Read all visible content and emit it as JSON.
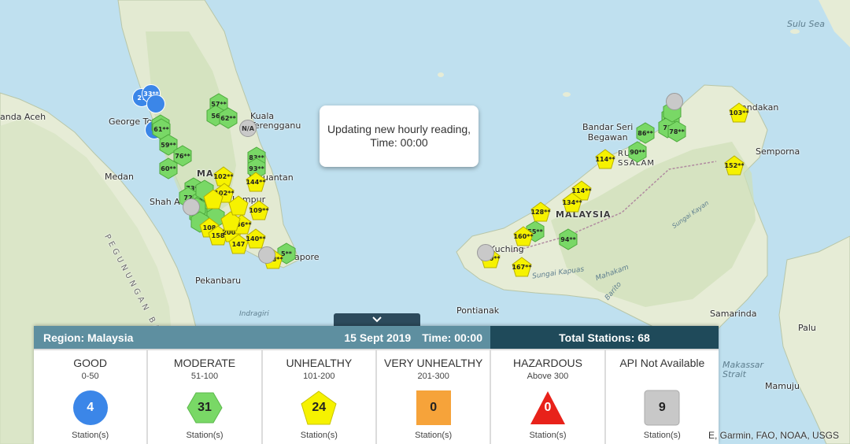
{
  "toast": {
    "line1": "Updating new hourly reading,",
    "line2": "Time: 00:00"
  },
  "panel": {
    "region": "Region: Malaysia",
    "date": "15 Sept 2019",
    "time": "Time: 00:00",
    "total": "Total Stations: 68",
    "categories": [
      {
        "title": "GOOD",
        "range": "0-50",
        "count": "4",
        "foot": "Station(s)",
        "shape": "circle",
        "color": "#3b86e8"
      },
      {
        "title": "MODERATE",
        "range": "51-100",
        "count": "31",
        "foot": "Station(s)",
        "shape": "hexagon",
        "color": "#79d866"
      },
      {
        "title": "UNHEALTHY",
        "range": "101-200",
        "count": "24",
        "foot": "Station(s)",
        "shape": "pentagon",
        "color": "#f6f200"
      },
      {
        "title": "VERY UNHEALTHY",
        "range": "201-300",
        "count": "0",
        "foot": "Station(s)",
        "shape": "square",
        "color": "#f6a33a"
      },
      {
        "title": "HAZARDOUS",
        "range": "Above 300",
        "count": "0",
        "foot": "Station(s)",
        "shape": "triangle",
        "color": "#e8221a"
      },
      {
        "title": "API Not Available",
        "range": "",
        "count": "9",
        "foot": "Station(s)",
        "shape": "rounded-square",
        "color": "#c8c8c8"
      }
    ]
  },
  "attribution": "E, Garmin, FAO, NOAA, USGS",
  "map_labels": {
    "sulu_sea": "Sulu Sea",
    "banda_aceh": "anda Aceh",
    "george_town": "George To",
    "medan": "Medan",
    "kuala_terengganu": "Kuala\nTerengganu",
    "shah_alam": "Shah A",
    "kuala_lumpur": "uala Lumpur",
    "kuantan": "uantan",
    "singapore": "apore",
    "pekanbaru": "Pekanbaru",
    "pegunungan": "PEGUNUNGAN BA",
    "malaysia_west": "MA",
    "malaysia_west_s": "SI",
    "indragiri": "Indragiri",
    "bandar_seri_begawan": "Bandar Seri\nBegawan",
    "brunei": "RUNEI\nSSALAM",
    "sandakan": "andakan",
    "semporna": "Semporna",
    "malaysia_east": "MALAYSIA",
    "kuching": "Kuching",
    "pontianak": "Pontianak",
    "sungai_kapuas": "Sungai Kapuas",
    "mahakam": "Mahakam",
    "samarinda": "Samarinda",
    "palu": "Palu",
    "makassar": "Makassar\nStrait",
    "mamuju": "Mamuju",
    "barito": "Barito",
    "sungai_kayan": "Sungai Kayan"
  },
  "markers": [
    {
      "label": "27",
      "type": "good"
    },
    {
      "label": "33**",
      "type": "good"
    },
    {
      "label": "",
      "type": "good"
    },
    {
      "label": "",
      "type": "good"
    },
    {
      "label": "57**",
      "type": "moderate"
    },
    {
      "label": "56",
      "type": "moderate"
    },
    {
      "label": "62**",
      "type": "moderate"
    },
    {
      "label": "",
      "type": "moderate"
    },
    {
      "label": "61**",
      "type": "moderate"
    },
    {
      "label": "59**",
      "type": "moderate"
    },
    {
      "label": "76**",
      "type": "moderate"
    },
    {
      "label": "60**",
      "type": "moderate"
    },
    {
      "label": "83**",
      "type": "moderate"
    },
    {
      "label": "93**",
      "type": "moderate"
    },
    {
      "label": "73**",
      "type": "moderate"
    },
    {
      "label": "72",
      "type": "moderate"
    },
    {
      "label": "90**",
      "type": "moderate"
    },
    {
      "label": "",
      "type": "moderate"
    },
    {
      "label": "",
      "type": "moderate"
    },
    {
      "label": "",
      "type": "moderate"
    },
    {
      "label": "",
      "type": "moderate"
    },
    {
      "label": "",
      "type": "moderate"
    },
    {
      "label": "",
      "type": "moderate"
    },
    {
      "label": "5**",
      "type": "moderate"
    },
    {
      "label": "86**",
      "type": "moderate"
    },
    {
      "label": "90**",
      "type": "moderate"
    },
    {
      "label": "73**",
      "type": "moderate"
    },
    {
      "label": "73",
      "type": "moderate"
    },
    {
      "label": "78**",
      "type": "moderate"
    },
    {
      "label": "",
      "type": "moderate"
    },
    {
      "label": "55**",
      "type": "moderate"
    },
    {
      "label": "94**",
      "type": "moderate"
    },
    {
      "label": "102**",
      "type": "unhealthy"
    },
    {
      "label": "102**",
      "type": "unhealthy"
    },
    {
      "label": "144**",
      "type": "unhealthy"
    },
    {
      "label": "109**",
      "type": "unhealthy"
    },
    {
      "label": "108",
      "type": "unhealthy"
    },
    {
      "label": "158",
      "type": "unhealthy"
    },
    {
      "label": "200**",
      "type": "unhealthy"
    },
    {
      "label": "136**",
      "type": "unhealthy"
    },
    {
      "label": "147",
      "type": "unhealthy"
    },
    {
      "label": "140**",
      "type": "unhealthy"
    },
    {
      "label": "108**",
      "type": "unhealthy"
    },
    {
      "label": "",
      "type": "unhealthy"
    },
    {
      "label": "103**",
      "type": "unhealthy"
    },
    {
      "label": "152**",
      "type": "unhealthy"
    },
    {
      "label": "114**",
      "type": "unhealthy"
    },
    {
      "label": "114**",
      "type": "unhealthy"
    },
    {
      "label": "134**",
      "type": "unhealthy"
    },
    {
      "label": "128**",
      "type": "unhealthy"
    },
    {
      "label": "160**",
      "type": "unhealthy"
    },
    {
      "label": "190**",
      "type": "unhealthy"
    },
    {
      "label": "167**",
      "type": "unhealthy"
    },
    {
      "label": "",
      "type": "unhealthy"
    },
    {
      "label": "",
      "type": "unhealthy"
    },
    {
      "label": "N/A",
      "type": "na"
    },
    {
      "label": "",
      "type": "na"
    },
    {
      "label": "",
      "type": "na"
    },
    {
      "label": "",
      "type": "na"
    },
    {
      "label": "",
      "type": "na"
    }
  ]
}
